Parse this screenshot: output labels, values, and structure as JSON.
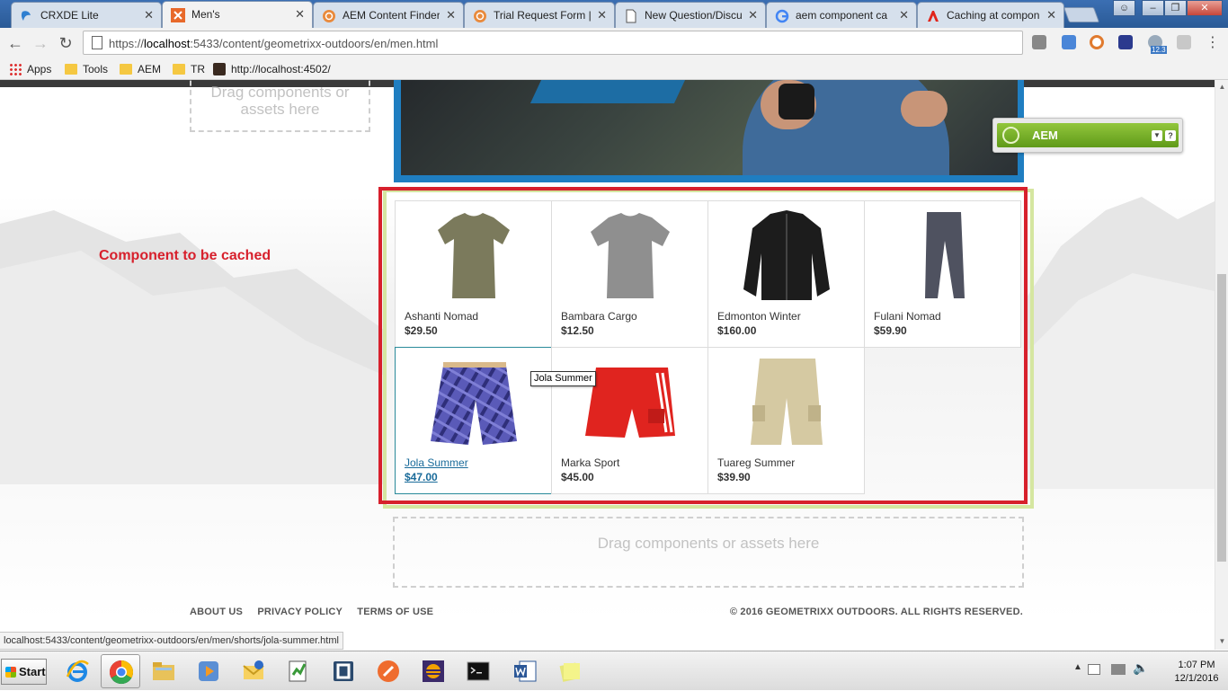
{
  "browser": {
    "tabs": [
      {
        "title": "CRXDE Lite",
        "icon": "crxde-icon",
        "active": false
      },
      {
        "title": "Men's",
        "icon": "geometrixx-icon",
        "active": true
      },
      {
        "title": "AEM Content Finder",
        "icon": "aem-icon",
        "active": false
      },
      {
        "title": "Trial Request Form |",
        "icon": "aem-icon",
        "active": false
      },
      {
        "title": "New Question/Discu",
        "icon": "page-icon",
        "active": false
      },
      {
        "title": "aem component ca",
        "icon": "google-icon",
        "active": false
      },
      {
        "title": "Caching at compon",
        "icon": "adobe-icon",
        "active": false
      }
    ],
    "close_glyph": "✕",
    "url": "https://localhost:5433/content/geometrixx-outdoors/en/men.html",
    "url_host": "localhost",
    "url_prefix": "https://",
    "url_rest": ":5433/content/geometrixx-outdoors/en/men.html",
    "bookmarks": [
      {
        "label": "Apps",
        "kind": "apps"
      },
      {
        "label": "Tools",
        "kind": "folder"
      },
      {
        "label": "AEM",
        "kind": "folder"
      },
      {
        "label": "TR",
        "kind": "folder"
      },
      {
        "label": "http://localhost:4502/",
        "kind": "page"
      }
    ],
    "extension_badge": "12.3",
    "status_url": "localhost:5433/content/geometrixx-outdoors/en/men/shorts/jola-summer.html"
  },
  "page": {
    "dropzone_top": "Drag components or assets here",
    "dropzone_bottom": "Drag components or assets here",
    "annotation": "Component to be cached",
    "tooltip": "Jola Summer",
    "aem_panel_label": "AEM",
    "aem_help": "?",
    "products": [
      {
        "name": "Ashanti Nomad",
        "price": "$29.50",
        "art": "tshirt-olive"
      },
      {
        "name": "Bambara Cargo",
        "price": "$12.50",
        "art": "tshirt-grey"
      },
      {
        "name": "Edmonton Winter",
        "price": "$160.00",
        "art": "jacket-black"
      },
      {
        "name": "Fulani Nomad",
        "price": "$59.90",
        "art": "pants-grey"
      },
      {
        "name": "Jola Summer",
        "price": "$47.00",
        "art": "shorts-plaid",
        "selected": true
      },
      {
        "name": "Marka Sport",
        "price": "$45.00",
        "art": "shorts-red"
      },
      {
        "name": "Tuareg Summer",
        "price": "$39.90",
        "art": "shorts-khaki"
      }
    ],
    "footer": {
      "links": [
        "ABOUT US",
        "PRIVACY POLICY",
        "TERMS OF USE"
      ],
      "copyright": "© 2016 GEOMETRIXX OUTDOORS. ALL RIGHTS RESERVED."
    }
  },
  "taskbar": {
    "start_label": "Start",
    "clock_time": "1:07 PM",
    "clock_date": "12/1/2016",
    "app_icons": [
      "ie-icon",
      "chrome-icon",
      "explorer-icon",
      "media-player-icon",
      "outlook-icon",
      "notepad-plus-icon",
      "sublime-icon",
      "postman-icon",
      "eclipse-icon",
      "cmd-icon",
      "word-icon",
      "sticky-notes-icon"
    ]
  },
  "colors": {
    "annotation_red": "#d7202c",
    "component_green": "#d5e6a0",
    "aem_green": "#6fa822",
    "link_blue": "#1a6b9a"
  }
}
